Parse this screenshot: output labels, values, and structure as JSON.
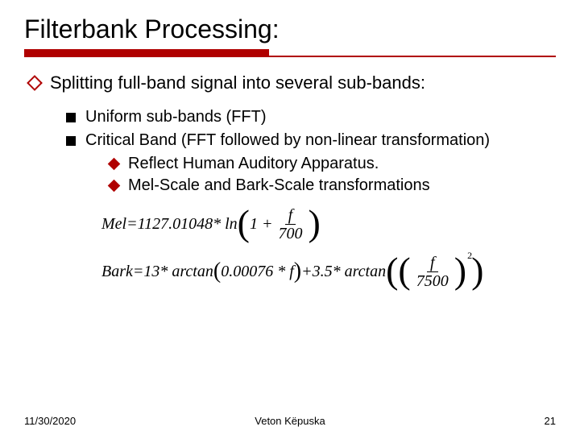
{
  "title": "Filterbank Processing:",
  "bullets": {
    "l1": "Splitting full-band signal into several sub-bands:",
    "l2a": "Uniform sub-bands (FFT)",
    "l2b": "Critical Band (FFT followed by non-linear transformation)",
    "l3a": "Reflect Human Auditory Apparatus.",
    "l3b": "Mel-Scale and Bark-Scale transformations"
  },
  "formulas": {
    "mel": {
      "lhs": "Mel",
      "eq": " = ",
      "coef": "1127.01048",
      "op": " * ln",
      "inner_prefix": "1 + ",
      "frac_num": "f",
      "frac_den": "700"
    },
    "bark": {
      "lhs": "Bark",
      "eq": " = ",
      "t1_coef": "13",
      "t1_op": " * arctan",
      "t1_inner": "0.00076 * f",
      "plus": " + ",
      "t2_coef": "3.5",
      "t2_op": " * arctan",
      "t2_frac_num": "f",
      "t2_frac_den": "7500",
      "t2_exp": "2"
    }
  },
  "footer": {
    "date": "11/30/2020",
    "author": "Veton Këpuska",
    "page": "21"
  }
}
